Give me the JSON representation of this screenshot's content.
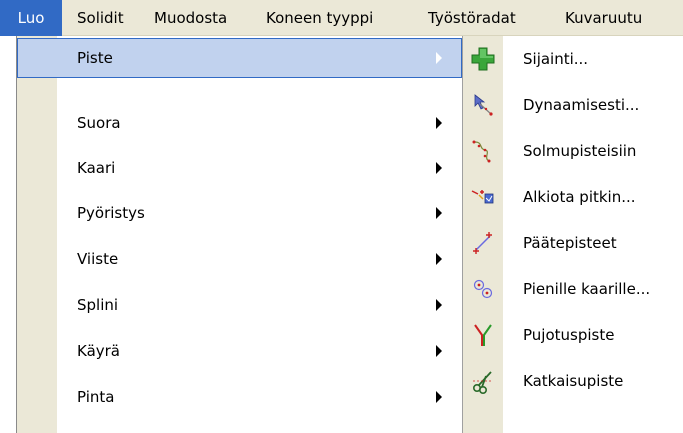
{
  "menubar": {
    "items": [
      {
        "label": "Luo",
        "active": true
      },
      {
        "label": "Solidit"
      },
      {
        "label": "Muodosta"
      },
      {
        "label": "Koneen tyyppi"
      },
      {
        "label": "Työstöradat"
      },
      {
        "label": "Kuvaruutu"
      }
    ]
  },
  "luo_menu": {
    "items": [
      {
        "label": "Piste",
        "selected": true,
        "has_submenu": true
      },
      {
        "label": "Suora",
        "has_submenu": true
      },
      {
        "label": "Kaari",
        "has_submenu": true
      },
      {
        "label": "Pyöristys",
        "has_submenu": true
      },
      {
        "label": "Viiste",
        "has_submenu": true
      },
      {
        "label": "Splini",
        "has_submenu": true
      },
      {
        "label": "Käyrä",
        "has_submenu": true
      },
      {
        "label": "Pinta",
        "has_submenu": true
      }
    ]
  },
  "piste_submenu": {
    "items": [
      {
        "label": "Sijainti...",
        "icon": "green-plus-icon"
      },
      {
        "label": "Dynaamisesti...",
        "icon": "dynamic-point-icon"
      },
      {
        "label": "Solmupisteisiin",
        "icon": "node-points-icon"
      },
      {
        "label": "Alkiota pitkin...",
        "icon": "along-entity-icon"
      },
      {
        "label": "Päätepisteet",
        "icon": "endpoints-icon"
      },
      {
        "label": "Pienille kaarille...",
        "icon": "small-arcs-icon"
      },
      {
        "label": "Pujotuspiste",
        "icon": "branch-point-icon"
      },
      {
        "label": "Katkaisupiste",
        "icon": "scissors-cut-icon"
      }
    ]
  },
  "colors": {
    "menubar_bg": "#ebe8d7",
    "active_bg": "#316ac5",
    "selected_bg": "#c1d2ee",
    "gutter_bg": "#ebe8d7"
  }
}
